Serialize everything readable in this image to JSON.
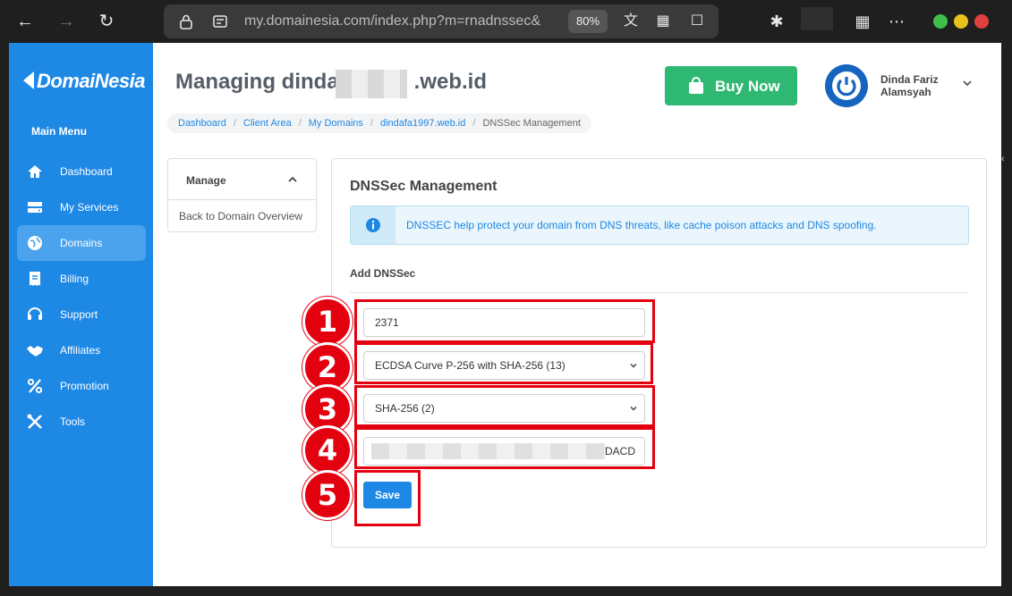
{
  "browser": {
    "url": "my.domainesia.com/index.php?m=rnadnssec&",
    "zoom": "80%"
  },
  "sidebar": {
    "logo_text": "DomaiNesia",
    "menu_title": "Main Menu",
    "items": [
      {
        "label": "Dashboard",
        "icon": "home-icon",
        "active": false
      },
      {
        "label": "My Services",
        "icon": "server-icon",
        "active": false
      },
      {
        "label": "Domains",
        "icon": "globe-icon",
        "active": true
      },
      {
        "label": "Billing",
        "icon": "receipt-icon",
        "active": false
      },
      {
        "label": "Support",
        "icon": "headset-icon",
        "active": false
      },
      {
        "label": "Affiliates",
        "icon": "handshake-icon",
        "active": false
      },
      {
        "label": "Promotion",
        "icon": "percent-icon",
        "active": false
      },
      {
        "label": "Tools",
        "icon": "tools-icon",
        "active": false
      }
    ]
  },
  "header": {
    "title_prefix": "Managing dinda",
    "title_suffix": ".web.id",
    "buy_label": "Buy Now",
    "user_name": "Dinda Fariz Alamsyah"
  },
  "breadcrumb": [
    "Dashboard",
    "Client Area",
    "My Domains",
    "dindafa1997.web.id",
    "DNSSec Management"
  ],
  "manage": {
    "title": "Manage",
    "link": "Back to Domain Overview"
  },
  "panel": {
    "title": "DNSSec Management",
    "alert": "DNSSEC help protect your domain from DNS threats, like cache poison attacks and DNS spoofing.",
    "section_label": "Add DNSSec",
    "key_tag": "2371",
    "algorithm": "ECDSA Curve P-256 with SHA-256 (13)",
    "digest_type": "SHA-256 (2)",
    "digest_tail": "DACD",
    "save_label": "Save"
  },
  "steps": [
    "1",
    "2",
    "3",
    "4",
    "5"
  ],
  "colors": {
    "sidebar": "#1e88e5",
    "buy": "#2eb872",
    "callout": "#e3000f",
    "primary": "#1e88e5"
  }
}
